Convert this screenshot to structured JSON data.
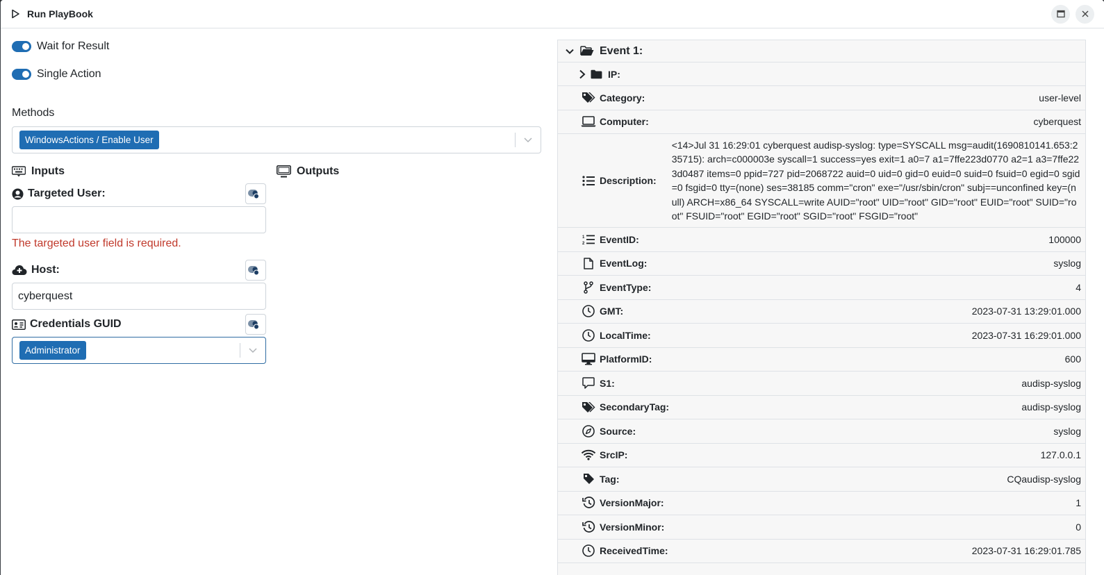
{
  "window": {
    "title": "Run PlayBook"
  },
  "toggles": [
    {
      "label": "Wait for Result",
      "on": true
    },
    {
      "label": "Single Action",
      "on": true
    }
  ],
  "methods": {
    "label": "Methods",
    "selected": "WindowsActions / Enable User"
  },
  "inputs": {
    "title": "Inputs",
    "targeted_user": {
      "label": "Targeted User:",
      "value": "",
      "error": "The targeted user field is required."
    },
    "host": {
      "label": "Host:",
      "value": "cyberquest"
    },
    "credentials": {
      "label": "Credentials GUID",
      "selected": "Administrator"
    }
  },
  "outputs": {
    "title": "Outputs"
  },
  "event": {
    "title": "Event 1:",
    "ip_label": "IP:",
    "props": [
      {
        "icon": "tags-icon",
        "name": "Category:",
        "value": "user-level"
      },
      {
        "icon": "laptop-icon",
        "name": "Computer:",
        "value": "cyberquest"
      },
      {
        "icon": "list-icon",
        "name": "Description:",
        "value": "<14>Jul 31 16:29:01 cyberquest audisp-syslog: type=SYSCALL msg=audit(1690810141.653:235715): arch=c000003e syscall=1 success=yes exit=1 a0=7 a1=7ffe223d0770 a2=1 a3=7ffe223d0487 items=0 ppid=727 pid=2068722 auid=0 uid=0 gid=0 euid=0 suid=0 fsuid=0 egid=0 sgid=0 fsgid=0 tty=(none) ses=38185 comm=\"cron\" exe=\"/usr/sbin/cron\" subj==unconfined key=(null) ARCH=x86_64 SYSCALL=write AUID=\"root\" UID=\"root\" GID=\"root\" EUID=\"root\" SUID=\"root\" FSUID=\"root\" EGID=\"root\" SGID=\"root\" FSGID=\"root\""
      },
      {
        "icon": "list-ol-icon",
        "name": "EventID:",
        "value": "100000"
      },
      {
        "icon": "file-icon",
        "name": "EventLog:",
        "value": "syslog"
      },
      {
        "icon": "code-branch-icon",
        "name": "EventType:",
        "value": "4"
      },
      {
        "icon": "clock-icon",
        "name": "GMT:",
        "value": "2023-07-31 13:29:01.000"
      },
      {
        "icon": "clock-icon",
        "name": "LocalTime:",
        "value": "2023-07-31 16:29:01.000"
      },
      {
        "icon": "desktop-icon",
        "name": "PlatformID:",
        "value": "600"
      },
      {
        "icon": "comment-icon",
        "name": "S1:",
        "value": "audisp-syslog"
      },
      {
        "icon": "tags-icon",
        "name": "SecondaryTag:",
        "value": "audisp-syslog"
      },
      {
        "icon": "compass-icon",
        "name": "Source:",
        "value": "syslog"
      },
      {
        "icon": "wifi-icon",
        "name": "SrcIP:",
        "value": "127.0.0.1"
      },
      {
        "icon": "tag-icon",
        "name": "Tag:",
        "value": "CQaudisp-syslog"
      },
      {
        "icon": "history-icon",
        "name": "VersionMajor:",
        "value": "1"
      },
      {
        "icon": "history-icon",
        "name": "VersionMinor:",
        "value": "0"
      },
      {
        "icon": "clock-icon",
        "name": "ReceivedTime:",
        "value": "2023-07-31 16:29:01.785"
      }
    ]
  },
  "colors": {
    "accent": "#1f6db3",
    "error": "#c0392b"
  }
}
